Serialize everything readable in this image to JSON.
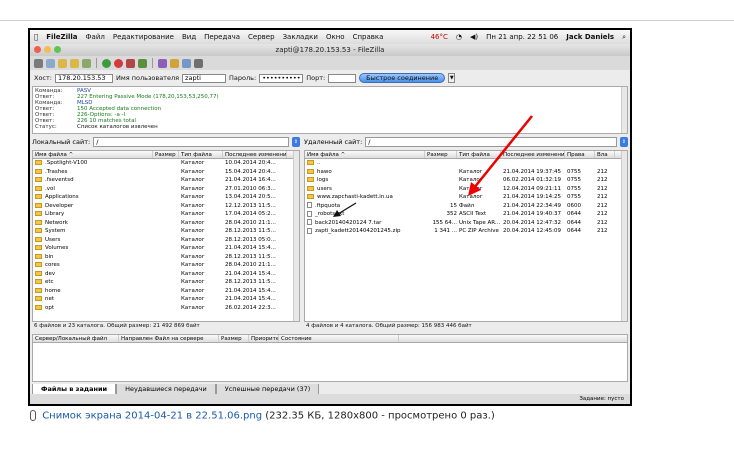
{
  "menubar": {
    "apple": "",
    "items": [
      "FileZilla",
      "Файл",
      "Редактирование",
      "Вид",
      "Передача",
      "Сервер",
      "Закладки",
      "Окно",
      "Справка"
    ],
    "temp": "46°C",
    "datetime": "Пн 21 апр. 22 51 06",
    "user": "Jack Daniels"
  },
  "window_title": "zapti@178.20.153.53 - FileZilla",
  "quickconnect": {
    "host_label": "Хост:",
    "host": "178.20.153.53",
    "user_label": "Имя пользователя",
    "user": "zapti",
    "pass_label": "Пароль:",
    "pass": "••••••••••",
    "port_label": "Порт:",
    "port": "",
    "button": "Быстрое соединение"
  },
  "log": [
    {
      "k": "Команда:",
      "v": "PASV",
      "c": "blue"
    },
    {
      "k": "Ответ:",
      "v": "227 Entering Passive Mode (178,20,153,53,250,77)",
      "c": "green"
    },
    {
      "k": "Команда:",
      "v": "MLSD",
      "c": "blue"
    },
    {
      "k": "Ответ:",
      "v": "150 Accepted data connection",
      "c": "green"
    },
    {
      "k": "Ответ:",
      "v": "226-Options: -a -l",
      "c": "green"
    },
    {
      "k": "Ответ:",
      "v": "226 10 matches total",
      "c": "green"
    },
    {
      "k": "Статус:",
      "v": "Список каталогов извлечен",
      "c": "plain"
    }
  ],
  "local": {
    "site_label": "Локальный сайт:",
    "site": "/",
    "columns": [
      "Имя файла ^",
      "Размер",
      "Тип файла",
      "Последнее изменение"
    ],
    "rows": [
      {
        "n": ".Spotlight-V100",
        "s": "",
        "t": "Каталог",
        "d": "10.04.2014 20:4..."
      },
      {
        "n": ".Trashes",
        "s": "",
        "t": "Каталог",
        "d": "15.04.2014 20:4..."
      },
      {
        "n": ".fseventsd",
        "s": "",
        "t": "Каталог",
        "d": "21.04.2014 16:4..."
      },
      {
        "n": ".vol",
        "s": "",
        "t": "Каталог",
        "d": "27.01.2010 06:3..."
      },
      {
        "n": "Applications",
        "s": "",
        "t": "Каталог",
        "d": "13.04.2014 20:5..."
      },
      {
        "n": "Developer",
        "s": "",
        "t": "Каталог",
        "d": "12.12.2013 11:5..."
      },
      {
        "n": "Library",
        "s": "",
        "t": "Каталог",
        "d": "17.04.2014 05:2..."
      },
      {
        "n": "Network",
        "s": "",
        "t": "Каталог",
        "d": "28.04.2010 21:1..."
      },
      {
        "n": "System",
        "s": "",
        "t": "Каталог",
        "d": "28.12.2013 11:5..."
      },
      {
        "n": "Users",
        "s": "",
        "t": "Каталог",
        "d": "28.12.2013 05:0..."
      },
      {
        "n": "Volumes",
        "s": "",
        "t": "Каталог",
        "d": "21.04.2014 15:4..."
      },
      {
        "n": "bin",
        "s": "",
        "t": "Каталог",
        "d": "28.12.2013 11:5..."
      },
      {
        "n": "cores",
        "s": "",
        "t": "Каталог",
        "d": "28.04.2010 21:1..."
      },
      {
        "n": "dev",
        "s": "",
        "t": "Каталог",
        "d": "21.04.2014 15:4..."
      },
      {
        "n": "etc",
        "s": "",
        "t": "Каталог",
        "d": "28.12.2013 11:5..."
      },
      {
        "n": "home",
        "s": "",
        "t": "Каталог",
        "d": "21.04.2014 15:4..."
      },
      {
        "n": "net",
        "s": "",
        "t": "Каталог",
        "d": "21.04.2014 15:4..."
      },
      {
        "n": "opt",
        "s": "",
        "t": "Каталог",
        "d": "26.02.2014 22:3..."
      }
    ],
    "status": "6 файлов и 23 каталога. Общий размер: 21 492 869 байт"
  },
  "remote": {
    "site_label": "Удаленный сайт:",
    "site": "/",
    "columns": [
      "Имя файла ^",
      "Размер",
      "Тип файла",
      "Последнее изменение",
      "Права",
      "Вла"
    ],
    "rows": [
      {
        "n": "..",
        "s": "",
        "t": "",
        "d": "",
        "p": "",
        "o": "",
        "icon": "folder"
      },
      {
        "n": "hawo",
        "s": "",
        "t": "Каталог",
        "d": "21.04.2014 19:37:45",
        "p": "0755",
        "o": "212",
        "icon": "folder"
      },
      {
        "n": "logs",
        "s": "",
        "t": "Каталог",
        "d": "06.02.2014 01:32:19",
        "p": "0755",
        "o": "212",
        "icon": "folder"
      },
      {
        "n": "users",
        "s": "",
        "t": "Каталог",
        "d": "12.04.2014 09:21:11",
        "p": "0755",
        "o": "212",
        "icon": "folder"
      },
      {
        "n": "www.zapchasti-kadett.in.ua",
        "s": "",
        "t": "Каталог",
        "d": "21.04.2014 19:14:25",
        "p": "0755",
        "o": "212",
        "icon": "folder"
      },
      {
        "n": ".ftpquota",
        "s": "15",
        "t": "Файл",
        "d": "21.04.2014 22:34:49",
        "p": "0600",
        "o": "212",
        "icon": "doc"
      },
      {
        "n": "_robots.txt",
        "s": "352",
        "t": "ASCII Text",
        "d": "21.04.2014 19:40:37",
        "p": "0644",
        "o": "212",
        "icon": "doc"
      },
      {
        "n": "back20140420124 7.tar",
        "s": "155 64...",
        "t": "Unix Tape AR...",
        "d": "20.04.2014 12:47:32",
        "p": "0644",
        "o": "212",
        "icon": "doc"
      },
      {
        "n": "zapti_kadett201404201245.zip",
        "s": "1 341 ...",
        "t": "PC ZIP Archive",
        "d": "20.04.2014 12:45:09",
        "p": "0644",
        "o": "212",
        "icon": "doc"
      }
    ],
    "status": "4 файлов и 4 каталога. Общий размер: 156 983 446 байт"
  },
  "queue": {
    "columns": [
      "Сервер/Локальный файл",
      "Направлен Файл на сервере",
      "Размер",
      "Приорите",
      "Состояние"
    ]
  },
  "tabs": [
    "Файлы в задании",
    "Неудавшиеся передачи",
    "Успешные передачи (37)"
  ],
  "bottom_status": "Задание: пусто",
  "caption": {
    "link": "Снимок экрана 2014-04-21 в 22.51.06.png",
    "meta": "(232.35 КБ, 1280x800 - просмотрено 0 раз.)"
  }
}
